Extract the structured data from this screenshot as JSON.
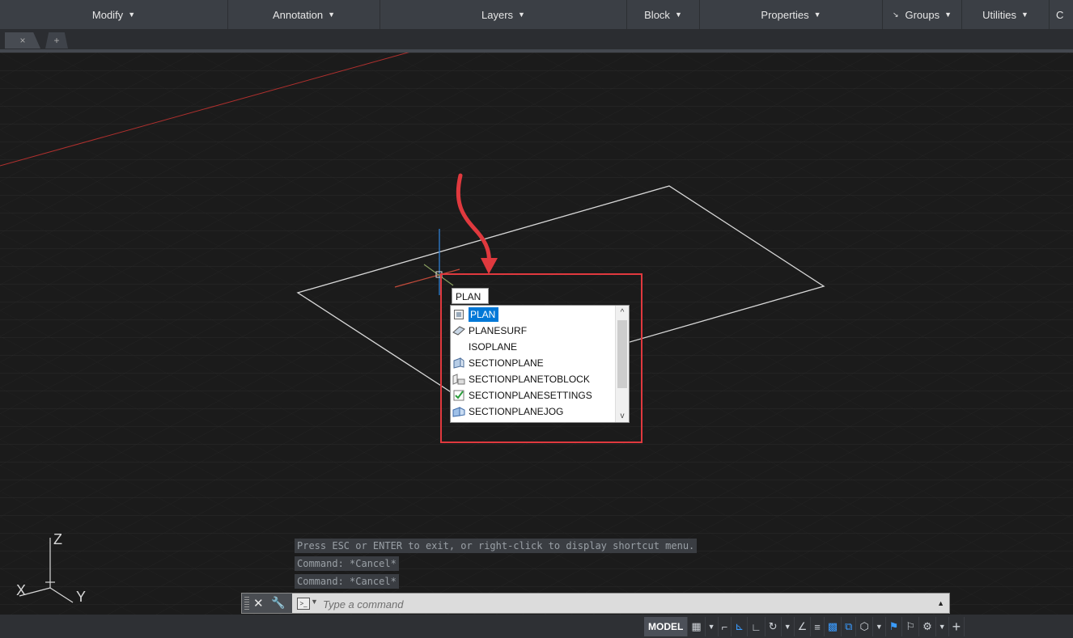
{
  "ribbon": {
    "panels": [
      {
        "label": "Modify",
        "has_caret": true
      },
      {
        "label": "Annotation",
        "has_caret": true
      },
      {
        "label": "Layers",
        "has_caret": true
      },
      {
        "label": "Block",
        "has_caret": true
      },
      {
        "label": "Properties",
        "has_caret": true
      },
      {
        "label": "Groups",
        "has_caret": true
      },
      {
        "label": "Utilities",
        "has_caret": true
      },
      {
        "label": "C",
        "has_caret": false
      }
    ]
  },
  "file_tabs": {
    "close_glyph": "×",
    "new_glyph": "+"
  },
  "autocomplete": {
    "typed_text": "PLAN",
    "items": [
      {
        "label": "PLAN",
        "icon": "plan-view-icon",
        "selected": true
      },
      {
        "label": "PLANESURF",
        "icon": "planar-surface-icon",
        "selected": false
      },
      {
        "label": "ISOPLANE",
        "icon": "",
        "selected": false
      },
      {
        "label": "SECTIONPLANE",
        "icon": "section-plane-icon",
        "selected": false
      },
      {
        "label": "SECTIONPLANETOBLOCK",
        "icon": "section-block-icon",
        "selected": false
      },
      {
        "label": "SECTIONPLANESETTINGS",
        "icon": "settings-check-icon",
        "selected": false
      },
      {
        "label": "SECTIONPLANEJOG",
        "icon": "section-jog-icon",
        "selected": false
      }
    ]
  },
  "command_history": [
    "Press ESC or ENTER to exit, or right-click to display shortcut menu.",
    "Command: *Cancel*",
    "Command: *Cancel*"
  ],
  "command_line": {
    "placeholder": "Type a command"
  },
  "ucs": {
    "x_label": "X",
    "y_label": "Y",
    "z_label": "Z"
  },
  "status_bar": {
    "model_label": "MODEL"
  },
  "colors": {
    "highlight": "#e0393e",
    "selection": "#0078d7",
    "x_axis": "#b0302e",
    "y_axis": "#2f7fd3",
    "accent_blue": "#3b9cff"
  }
}
